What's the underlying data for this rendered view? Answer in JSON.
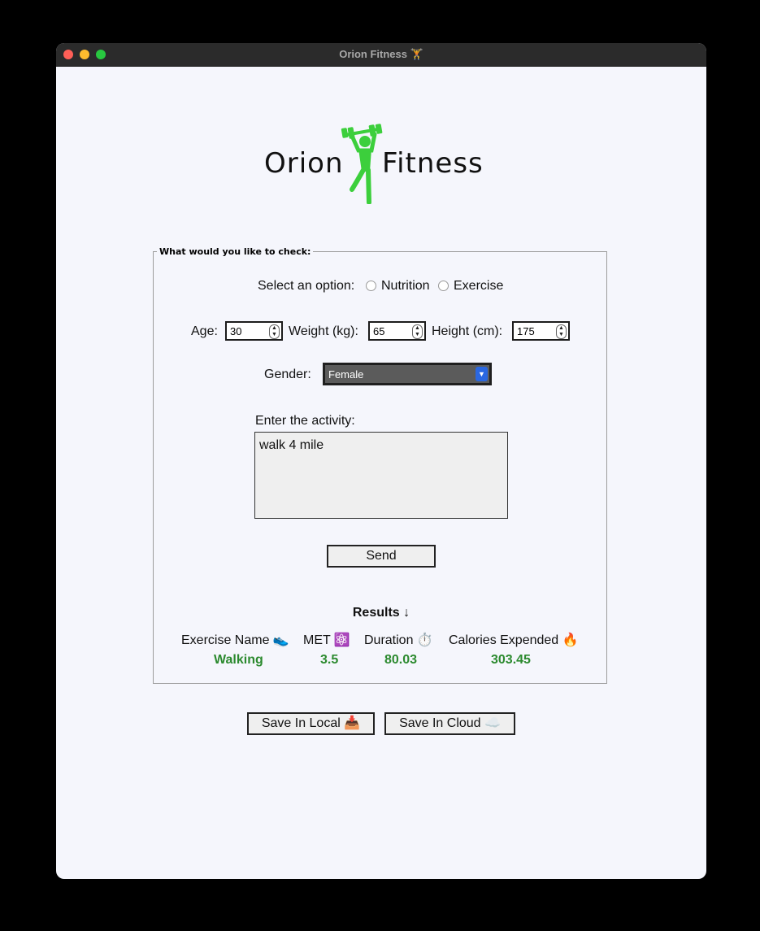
{
  "window": {
    "title": "Orion Fitness 🏋"
  },
  "logo": {
    "text_left": "Orion",
    "text_right": "Fitness",
    "colors": {
      "figure": "#3ccf3c",
      "text": "#111111"
    }
  },
  "form": {
    "legend": "What would you like to check:",
    "option_label": "Select an option:",
    "options": [
      {
        "label": "Nutrition",
        "selected": false
      },
      {
        "label": "Exercise",
        "selected": false
      }
    ],
    "age": {
      "label": "Age:",
      "value": "30"
    },
    "weight": {
      "label": "Weight (kg):",
      "value": "65"
    },
    "height": {
      "label": "Height (cm):",
      "value": "175"
    },
    "gender": {
      "label": "Gender:",
      "value": "Female"
    },
    "activity": {
      "label": "Enter the activity:",
      "value": "walk 4 mile"
    },
    "send_label": "Send"
  },
  "results": {
    "title": "Results ↓",
    "columns": [
      {
        "header": "Exercise Name 👟",
        "value": "Walking"
      },
      {
        "header": "MET ⚛️",
        "value": "3.5"
      },
      {
        "header": "Duration ⏱️",
        "value": "80.03"
      },
      {
        "header": "Calories Expended 🔥",
        "value": "303.45"
      }
    ],
    "value_color": "#2c8a2f"
  },
  "actions": {
    "save_local": "Save In Local 📥",
    "save_cloud": "Save In Cloud ☁️"
  }
}
